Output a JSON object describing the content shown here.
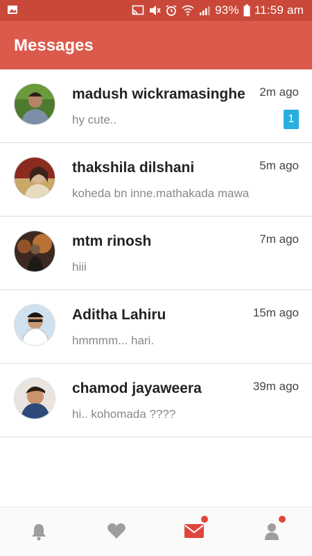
{
  "status_bar": {
    "battery": "93%",
    "time": "11:59 am",
    "icons": [
      "image-icon",
      "cast-icon",
      "mute-icon",
      "alarm-icon",
      "wifi-icon",
      "signal-icon",
      "battery-icon"
    ]
  },
  "header": {
    "title": "Messages"
  },
  "conversations": [
    {
      "name": "madush wickramasinghe",
      "preview": "hy cute..",
      "time": "2m ago",
      "unread": "1"
    },
    {
      "name": "thakshila dilshani",
      "preview": "koheda bn inne.mathakada mawa",
      "time": "5m ago"
    },
    {
      "name": "mtm rinosh",
      "preview": "hiii",
      "time": "7m ago"
    },
    {
      "name": "Aditha Lahiru",
      "preview": "hmmmm... hari.",
      "time": "15m ago"
    },
    {
      "name": "chamod jayaweera",
      "preview": "hi.. kohomada ????",
      "time": "39m ago"
    }
  ],
  "bottom_nav": {
    "items": [
      {
        "icon": "bell-icon",
        "active": false,
        "has_dot": false
      },
      {
        "icon": "heart-icon",
        "active": false,
        "has_dot": false
      },
      {
        "icon": "mail-icon",
        "active": true,
        "has_dot": true
      },
      {
        "icon": "user-icon",
        "active": false,
        "has_dot": true
      }
    ]
  },
  "colors": {
    "status_bar": "#c9483a",
    "app_bar": "#dc5a4c",
    "badge": "#29aee0",
    "active_icon": "#e0453b",
    "inactive_icon": "#9e9e9e"
  }
}
